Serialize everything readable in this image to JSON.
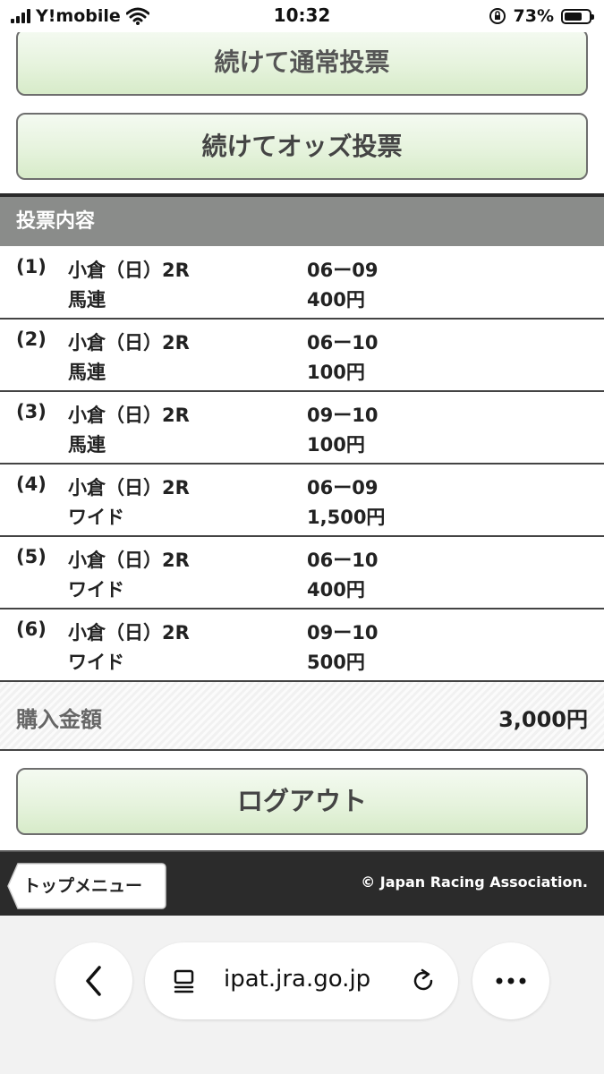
{
  "status_bar": {
    "carrier": "Y!mobile",
    "time": "10:32",
    "battery": "73%",
    "battery_level": 0.73
  },
  "buttons": {
    "normal_vote": "続けて通常投票",
    "odds_vote": "続けてオッズ投票",
    "logout": "ログアウト"
  },
  "section": {
    "title": "投票内容"
  },
  "bets": [
    {
      "num": "(1)",
      "venue": "小倉（日）2R",
      "type": "馬連",
      "combo": "06ー09",
      "amount": "400円"
    },
    {
      "num": "(2)",
      "venue": "小倉（日）2R",
      "type": "馬連",
      "combo": "06ー10",
      "amount": "100円"
    },
    {
      "num": "(3)",
      "venue": "小倉（日）2R",
      "type": "馬連",
      "combo": "09ー10",
      "amount": "100円"
    },
    {
      "num": "(4)",
      "venue": "小倉（日）2R",
      "type": "ワイド",
      "combo": "06ー09",
      "amount": "1,500円"
    },
    {
      "num": "(5)",
      "venue": "小倉（日）2R",
      "type": "ワイド",
      "combo": "06ー10",
      "amount": "400円"
    },
    {
      "num": "(6)",
      "venue": "小倉（日）2R",
      "type": "ワイド",
      "combo": "09ー10",
      "amount": "500円"
    }
  ],
  "total": {
    "label": "購入金額",
    "value": "3,000円"
  },
  "footer": {
    "top_menu": "トップメニュー",
    "copyright": "© Japan Racing Association."
  },
  "browser": {
    "url": "ipat.jra.go.jp"
  }
}
